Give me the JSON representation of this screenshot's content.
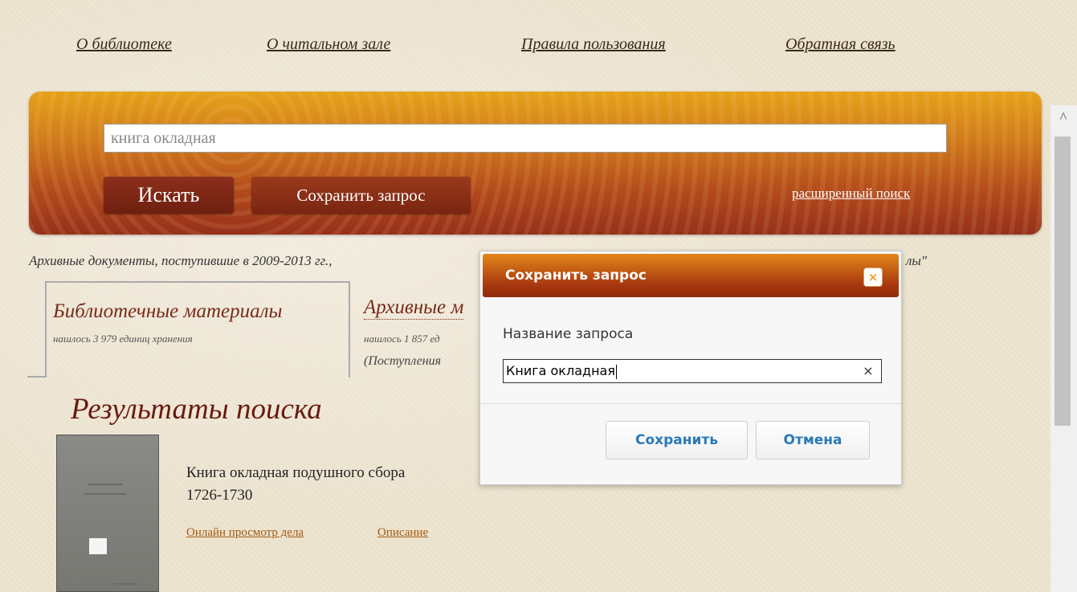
{
  "nav": {
    "items": [
      "О библиотеке",
      "О читальном зале",
      "Правила пользования",
      "Обратная связь"
    ]
  },
  "search": {
    "value": "книга окладная",
    "search_label": "Искать",
    "save_label": "Сохранить запрос",
    "advanced_label": "расширенный поиск"
  },
  "notice": {
    "text": "Архивные документы, поступившие в 2009-2013 гг.,",
    "tail": "лы\""
  },
  "tabs": [
    {
      "title": "Библиотечные материалы",
      "subtitle": "нашлось 3 979 единиц хранения"
    },
    {
      "title": "Архивные м",
      "subtitle": "нашлось 1 857 ед",
      "extra": "(Поступления"
    }
  ],
  "results": {
    "title": "Результаты поиска",
    "items": [
      {
        "title": "Книга окладная подушного сбора",
        "years": "1726-1730",
        "link_view": "Онлайн просмотр дела",
        "link_desc": "Описание"
      }
    ]
  },
  "dialog": {
    "title": "Сохранить запрос",
    "close_glyph": "×",
    "label": "Название запроса",
    "input_value": "Книга окладная",
    "clear_glyph": "×",
    "save_label": "Сохранить",
    "cancel_label": "Отмена"
  },
  "scrollbar": {
    "up_glyph": "^"
  },
  "colors": {
    "band_top": "#e6a21a",
    "band_bottom": "#96301a",
    "button_dark": "#7a2510",
    "dialog_header": "#a9390f",
    "dialog_button_text": "#2a7ab8",
    "link": "#a45a10"
  },
  "icons": {
    "dialog_close": "close-icon",
    "input_clear": "clear-icon",
    "scroll_up": "chevron-up-icon"
  }
}
